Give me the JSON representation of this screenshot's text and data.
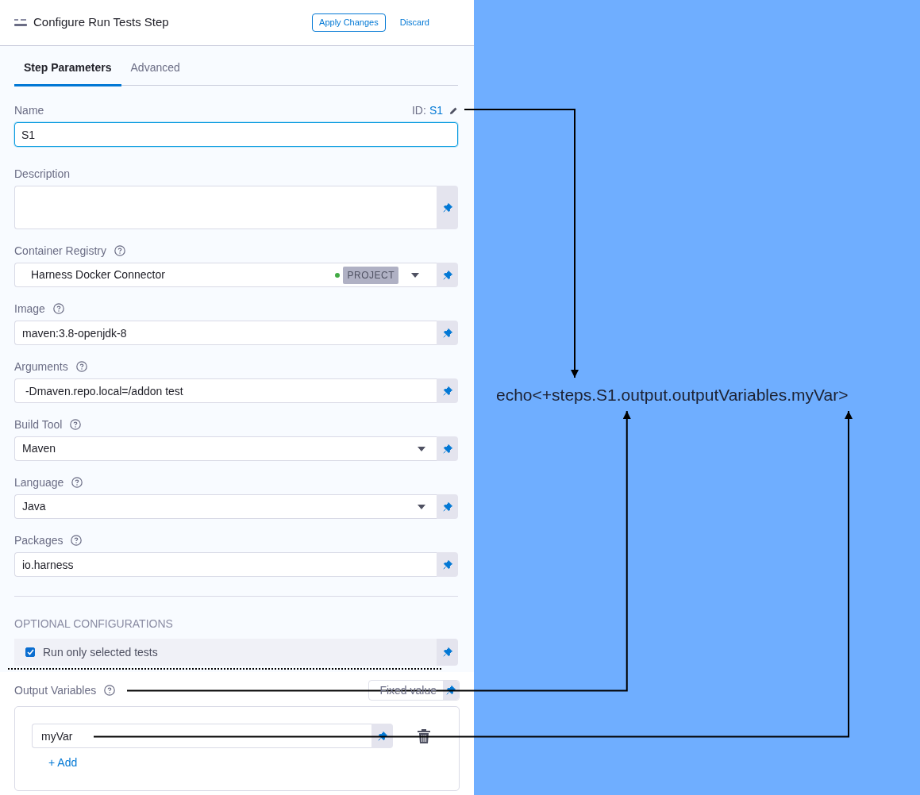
{
  "header": {
    "title": "Configure Run Tests Step",
    "apply": "Apply Changes",
    "discard": "Discard"
  },
  "tabs": [
    {
      "label": "Step Parameters",
      "selected": true
    },
    {
      "label": "Advanced",
      "selected": false
    }
  ],
  "name_field": {
    "label": "Name",
    "id_label": "ID:",
    "id_value": "S1",
    "value": "S1"
  },
  "fields": [
    {
      "kind": "textarea",
      "label": "Description",
      "help": false
    },
    {
      "kind": "connector",
      "label": "Container Registry",
      "help": true,
      "value": "Harness Docker Connector",
      "connected": true,
      "scope": "PROJECT"
    },
    {
      "kind": "text",
      "label": "Image",
      "help": true,
      "value": "maven:3.8-openjdk-8"
    },
    {
      "kind": "text",
      "label": "Arguments",
      "help": true,
      "value": " -Dmaven.repo.local=/addon test"
    },
    {
      "kind": "select",
      "label": "Build Tool",
      "help": true,
      "value": "Maven"
    },
    {
      "kind": "select",
      "label": "Language",
      "help": true,
      "value": "Java"
    },
    {
      "kind": "text",
      "label": "Packages",
      "help": true,
      "value": "io.harness"
    }
  ],
  "optional": {
    "heading": "OPTIONAL CONFIGURATIONS",
    "options": [
      {
        "label": "Run only selected tests",
        "checked": true
      }
    ]
  },
  "output_variables": {
    "label": "Output Variables",
    "help": true,
    "mode": "Fixed value",
    "variables": [
      {
        "value": "myVar"
      }
    ],
    "add": "+ Add"
  },
  "expression": "echo<+steps.S1.output.outputVariables.myVar>"
}
